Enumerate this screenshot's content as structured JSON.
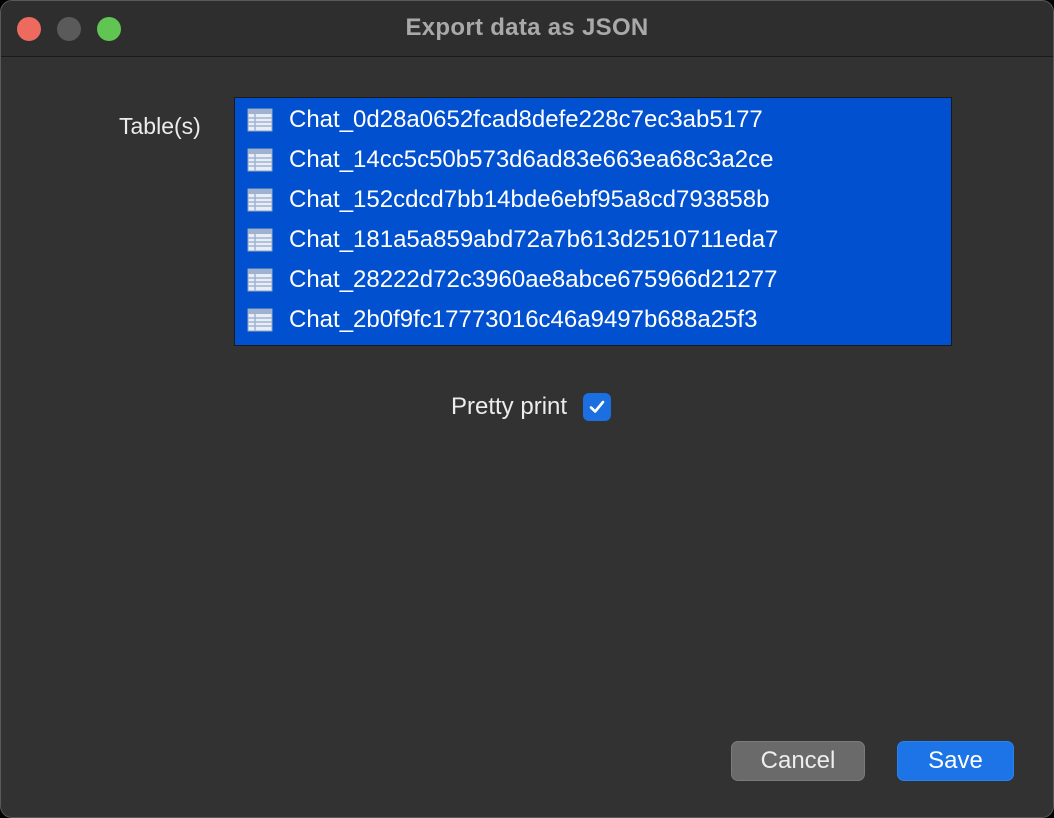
{
  "window": {
    "title": "Export data as JSON"
  },
  "tables": {
    "label": "Table(s)",
    "items": [
      {
        "name": "Chat_0d28a0652fcad8defe228c7ec3ab5177",
        "icon": "table-icon"
      },
      {
        "name": "Chat_14cc5c50b573d6ad83e663ea68c3a2ce",
        "icon": "table-icon"
      },
      {
        "name": "Chat_152cdcd7bb14bde6ebf95a8cd793858b",
        "icon": "table-icon"
      },
      {
        "name": "Chat_181a5a859abd72a7b613d2510711eda7",
        "icon": "table-icon"
      },
      {
        "name": "Chat_28222d72c3960ae8abce675966d21277",
        "icon": "table-icon"
      },
      {
        "name": "Chat_2b0f9fc17773016c46a9497b688a25f3",
        "icon": "table-icon"
      }
    ]
  },
  "options": {
    "pretty_print_label": "Pretty print",
    "pretty_print_checked": true
  },
  "buttons": {
    "cancel_label": "Cancel",
    "save_label": "Save"
  },
  "colors": {
    "window_bg": "#323232",
    "selection": "#0050d0",
    "accent": "#1d74e6",
    "close": "#ec6a5e",
    "maximize": "#61c554"
  }
}
